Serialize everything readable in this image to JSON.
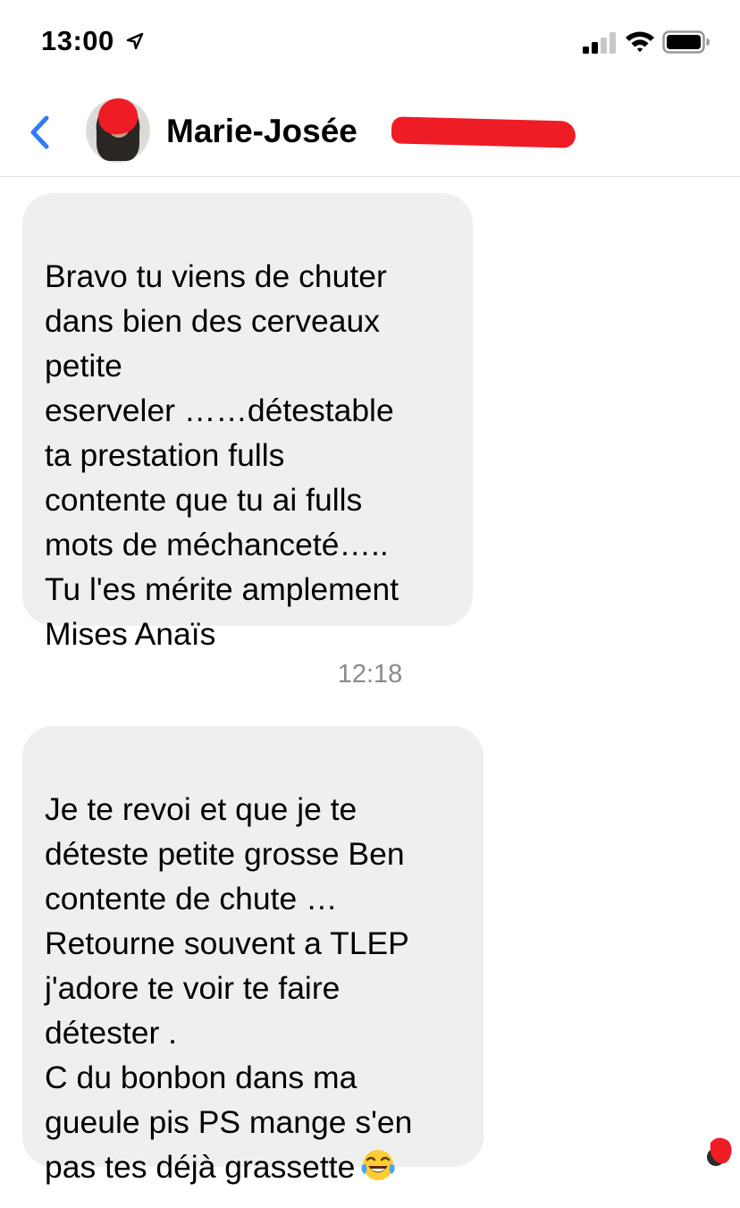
{
  "status_bar": {
    "time": "13:00",
    "location_icon": "location-arrow-icon",
    "signal_icon": "cellular-signal-icon",
    "wifi_icon": "wifi-icon",
    "battery_icon": "battery-icon"
  },
  "header": {
    "back_icon": "chevron-left-icon",
    "contact_name": "Marie-Josée",
    "accent_color": "#2f7cf6",
    "redaction_color": "#ee1c25"
  },
  "messages": [
    {
      "text": "Bravo tu viens de chuter\ndans bien des cerveaux\npetite\neserveler ……détestable\nta prestation fulls\ncontente que tu ai fulls\nmots de méchanceté…..\nTu l'es mérite amplement\nMises Anaïs"
    },
    {
      "text": "Je te revoi et que je te\ndéteste petite grosse Ben\ncontente de chute …\nRetourne souvent a TLEP\nj'adore te voir te faire\ndétester .\nC du bonbon dans ma\ngueule pis PS mange s'en\npas tes déjà grassette",
      "trailing_emoji": "laughing-tears-emoji"
    }
  ],
  "timestamp": "12:18",
  "bubble_color": "#efefef"
}
